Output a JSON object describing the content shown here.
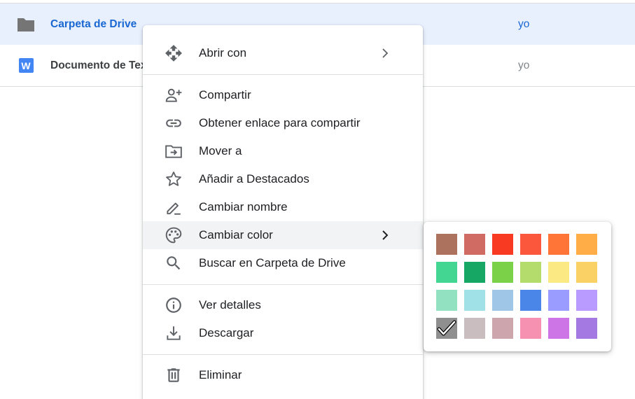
{
  "files": [
    {
      "name": "Carpeta de Drive",
      "owner": "yo",
      "type": "folder",
      "icon": "folder-icon",
      "selected": true
    },
    {
      "name": "Documento de Tex",
      "owner": "yo",
      "type": "document",
      "icon": "word-doc-icon",
      "badge": "W",
      "selected": false
    }
  ],
  "menu": {
    "open_with": "Abrir con",
    "share": "Compartir",
    "get_link": "Obtener enlace para compartir",
    "move_to": "Mover a",
    "add_starred": "Añadir a Destacados",
    "rename": "Cambiar nombre",
    "change_color": "Cambiar color",
    "search_in": "Buscar en Carpeta de Drive",
    "view_details": "Ver detalles",
    "download": "Descargar",
    "delete": "Eliminar"
  },
  "colors": {
    "selected_index": 18,
    "swatches": [
      "#ac725e",
      "#d06b64",
      "#f83a22",
      "#fa573c",
      "#ff7537",
      "#ffad46",
      "#42d692",
      "#16a765",
      "#7bd148",
      "#b3dc6c",
      "#fbe983",
      "#fad165",
      "#92e1c0",
      "#9fe1e7",
      "#9fc6e7",
      "#4986e7",
      "#9a9cff",
      "#b99aff",
      "#8f8f8f",
      "#cabdbf",
      "#cca6ac",
      "#f691b2",
      "#cd74e6",
      "#a47ae2"
    ]
  },
  "theme": {
    "icon_gray": "#5f6368",
    "accent_blue": "#1967d2",
    "selection_bg": "#e8f0fe"
  }
}
